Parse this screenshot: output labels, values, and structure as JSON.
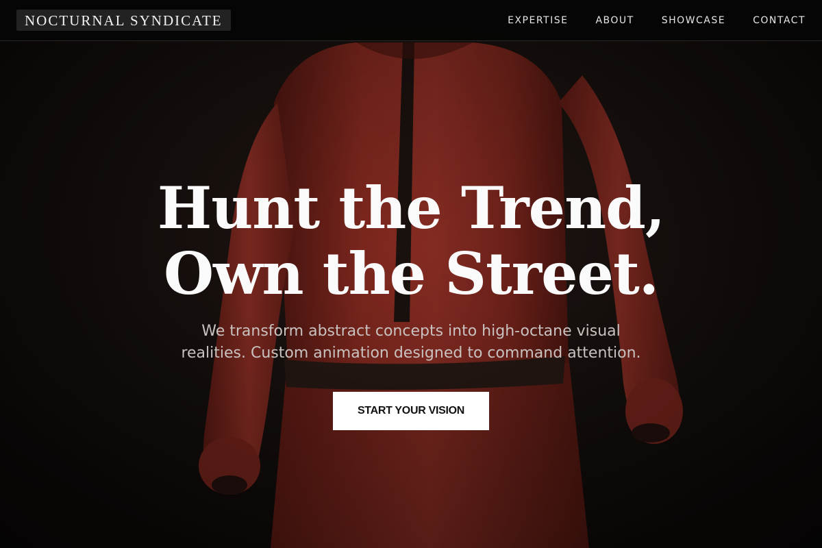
{
  "brand": {
    "name": "NOCTURNAL SYNDICATE"
  },
  "nav": {
    "items": [
      {
        "label": "EXPERTISE"
      },
      {
        "label": "ABOUT"
      },
      {
        "label": "SHOWCASE"
      },
      {
        "label": "CONTACT"
      }
    ]
  },
  "hero": {
    "headline_line1": "Hunt the Trend,",
    "headline_line2": "Own the Street.",
    "subtitle": "We transform abstract concepts into high-octane visual realities. Custom animation designed to command attention.",
    "cta_label": "START YOUR VISION",
    "background_subject": "figure in red suit seen from behind"
  },
  "colors": {
    "background": "#120e0c",
    "nav_bg": "#050505",
    "suit_red": "#8e2a20",
    "cta_bg": "#ffffff",
    "cta_text": "#111111",
    "headline": "#fafafa"
  }
}
